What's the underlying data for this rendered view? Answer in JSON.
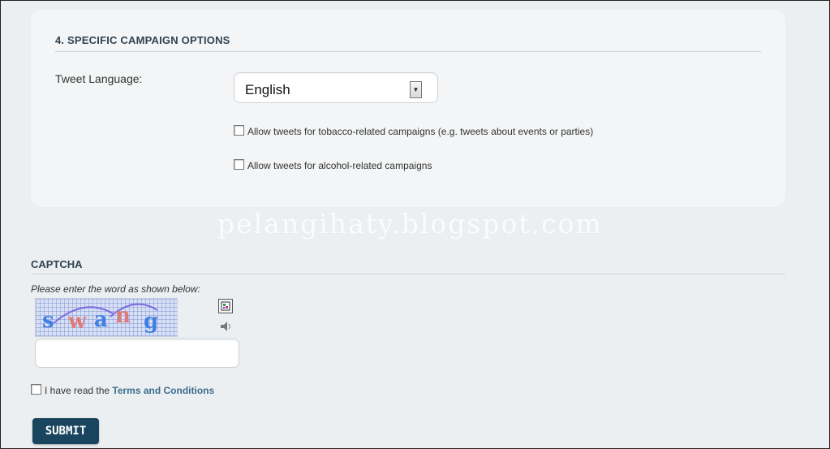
{
  "section": {
    "title": "4. SPECIFIC CAMPAIGN OPTIONS",
    "tweet_language_label": "Tweet Language:",
    "tweet_language_value": "English",
    "tobacco_label": "Allow tweets for tobacco-related campaigns (e.g. tweets about events or parties)",
    "tobacco_checked": false,
    "alcohol_label": "Allow tweets for alcohol-related campaigns",
    "alcohol_checked": false
  },
  "watermark": "pelangihaty.blogspot.com",
  "captcha": {
    "title": "CAPTCHA",
    "hint": "Please enter the word as shown below:",
    "word": [
      "s",
      "w",
      "a",
      "n",
      "g"
    ],
    "input_value": "",
    "refresh_icon": "refresh-captcha-icon",
    "audio_icon": "audio-captcha-icon"
  },
  "terms": {
    "prefix": "I have read the ",
    "link": "Terms and Conditions",
    "checked": false
  },
  "submit_label": "SUBMIT",
  "colors": {
    "heading": "#2f4352",
    "link": "#3a6d8c",
    "submit_bg": "#19455e"
  }
}
